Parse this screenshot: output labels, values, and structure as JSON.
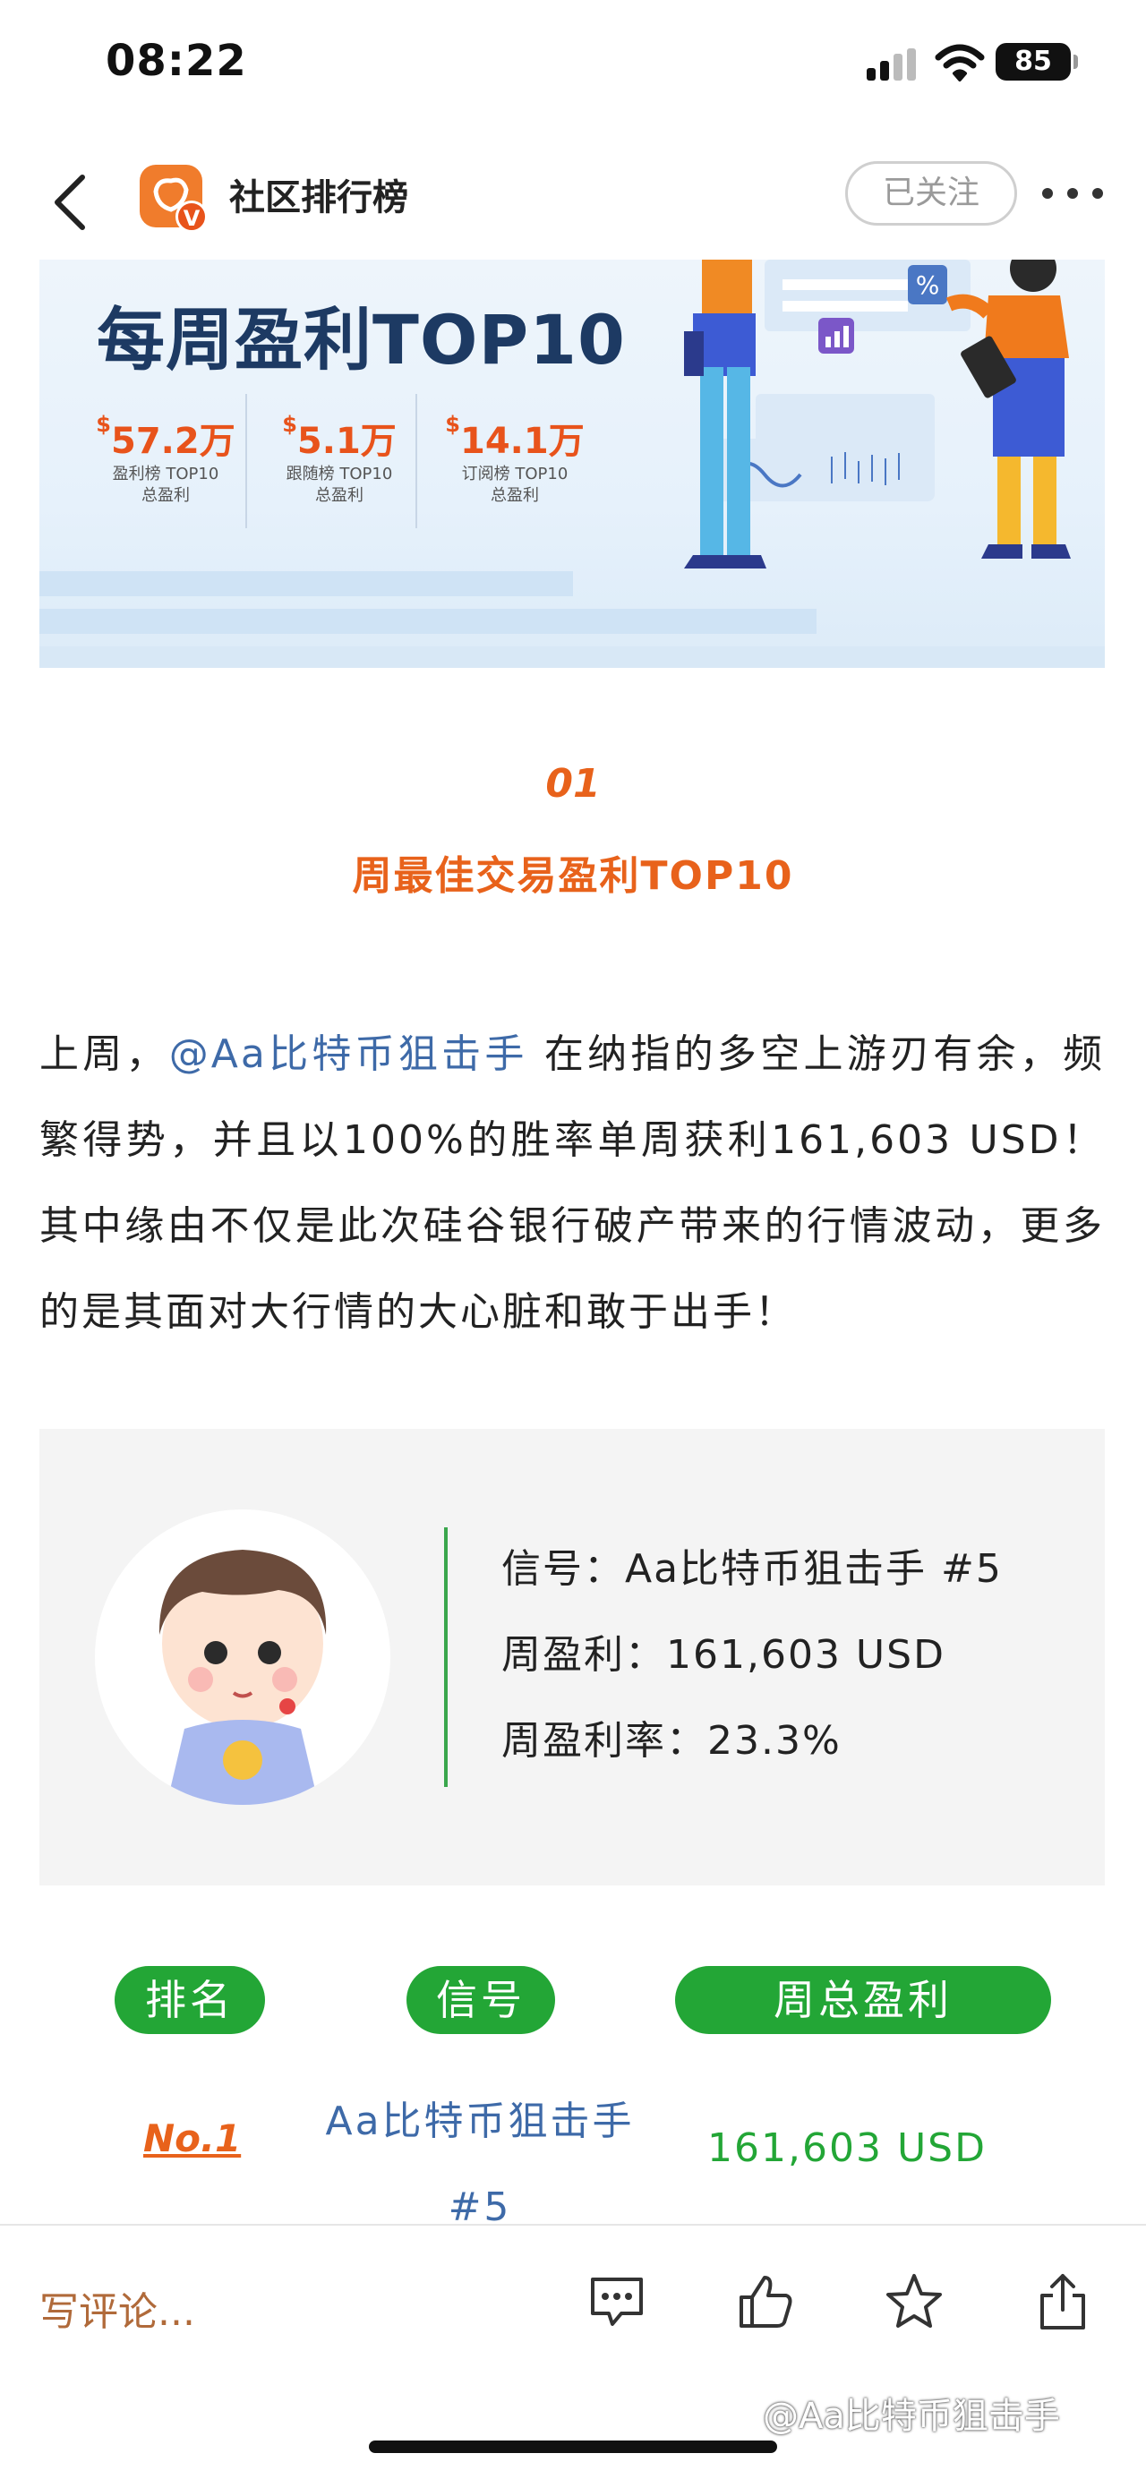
{
  "status_bar": {
    "time": "08:22",
    "battery": "85"
  },
  "header": {
    "title": "社区排行榜",
    "follow_label": "已关注",
    "app_badge": "V"
  },
  "banner": {
    "title": "每周盈利TOP10",
    "stats": [
      {
        "currency": "$",
        "value": "57.2万",
        "line1": "盈利榜 TOP10",
        "line2": "总盈利"
      },
      {
        "currency": "$",
        "value": "5.1万",
        "line1": "跟随榜 TOP10",
        "line2": "总盈利"
      },
      {
        "currency": "$",
        "value": "14.1万",
        "line1": "订阅榜 TOP10",
        "line2": "总盈利"
      }
    ],
    "icon_percent": "%"
  },
  "section": {
    "number": "01",
    "title": "周最佳交易盈利TOP10"
  },
  "paragraph": {
    "prefix": "上周，",
    "mention": "@Aa比特币狙击手",
    "body": " 在纳指的多空上游刃有余，频繁得势，并且以100%的胜率单周获利161,603 USD！其中缘由不仅是此次硅谷银行破产带来的行情波动，更多的是其面对大行情的大心脏和敢于出手！"
  },
  "card": {
    "signal": "信号：Aa比特币狙击手 #5",
    "weekly_profit": "周盈利：161,603 USD",
    "weekly_rate": "周盈利率：23.3%"
  },
  "table": {
    "headers": [
      "排名",
      "信号",
      "周总盈利"
    ],
    "rows": [
      {
        "rank": "No.1",
        "signal": "Aa比特币狙击手 #5",
        "profit": "161,603 USD"
      }
    ]
  },
  "bottom_bar": {
    "comment_placeholder": "写评论...",
    "watermark": "@Aa比特币狙击手"
  }
}
